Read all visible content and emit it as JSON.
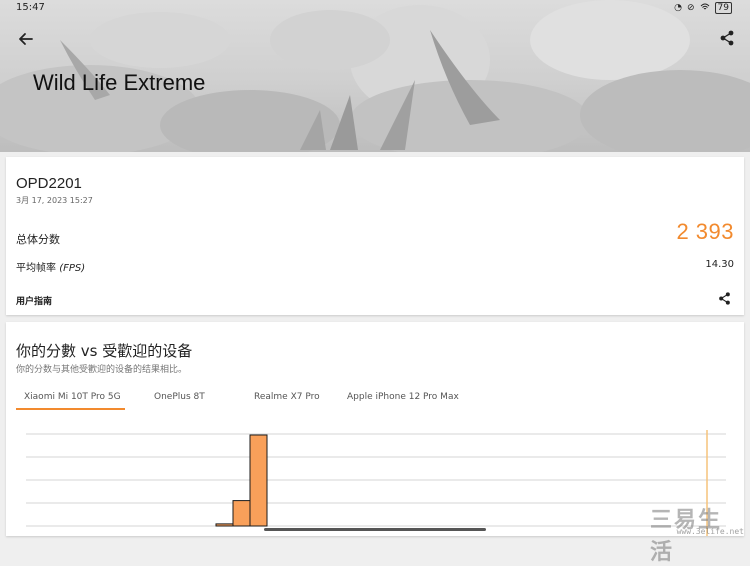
{
  "status_bar": {
    "time": "15:47",
    "battery": "79"
  },
  "header": {
    "title": "Wild Life Extreme"
  },
  "result": {
    "device": "OPD2201",
    "date": "3月 17, 2023 15:27",
    "score_label": "总体分数",
    "score": "2 393",
    "fps_label_prefix": "平均帧率",
    "fps_label_unit": "(FPS)",
    "fps_value": "14.30",
    "guide_label": "用户指南"
  },
  "comparison": {
    "title": "你的分數 vs 受歡迎的设备",
    "subtitle": "你的分数与其他受歡迎的设备的结果相比。",
    "tabs": [
      "Xiaomi Mi 10T Pro 5G",
      "OnePlus 8T",
      "Realme X7 Pro",
      "Apple iPhone 12 Pro Max"
    ],
    "active_tab": 0
  },
  "chart_data": {
    "type": "bar",
    "values": [
      1,
      12,
      43
    ],
    "gridlines": 5,
    "xlabel": "",
    "ylabel": ""
  },
  "watermark": {
    "main": "三易生活",
    "url": "www.3elife.net"
  },
  "colors": {
    "accent": "#f28a2e",
    "bar_fill": "#f9a05a",
    "bar_stroke": "#1a1a1a",
    "marker": "#f6c27a"
  },
  "icons": {
    "back": "arrow-left-icon",
    "share": "share-icon"
  }
}
